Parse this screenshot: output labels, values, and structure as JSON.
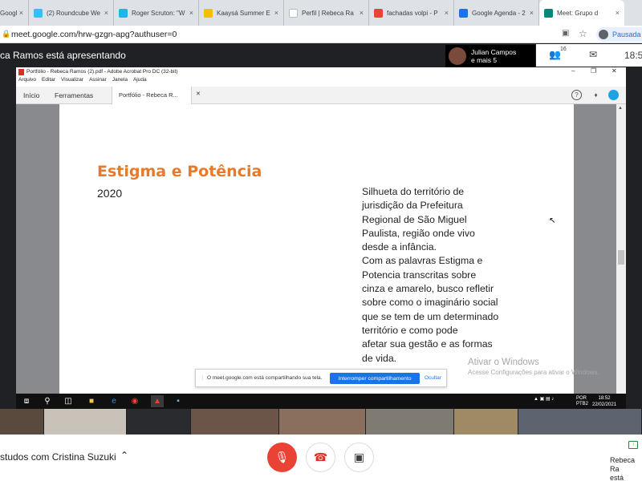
{
  "browser": {
    "tabs": [
      {
        "title": "Googl",
        "icon": "google-icon",
        "color": "#4285f4",
        "active": false
      },
      {
        "title": "(2) Roundcube We",
        "icon": "roundcube-icon",
        "color": "#37beff",
        "active": false
      },
      {
        "title": "Roger Scruton: \"W",
        "icon": "v-icon",
        "color": "#1ab7ea",
        "active": false
      },
      {
        "title": "Kaaysá Summer E",
        "icon": "drive-icon",
        "color": "#fbbc04",
        "active": false
      },
      {
        "title": "Perfil | Rebeca Ra",
        "icon": "page-icon",
        "color": "#ffffff",
        "active": false
      },
      {
        "title": "fachadas volpi - P",
        "icon": "google-g-icon",
        "color": "#ea4335",
        "active": false
      },
      {
        "title": "Google Agenda - 2",
        "icon": "calendar-icon",
        "color": "#1a73e8",
        "active": false
      },
      {
        "title": "Meet: Grupo d",
        "icon": "meet-icon",
        "color": "#00897b",
        "active": true
      }
    ],
    "url": "meet.google.com/hrw-gzgn-apg?authuser=0",
    "profile_label": "Pausada"
  },
  "meet": {
    "presenting_banner": "ca Ramos está apresentando",
    "pip_name": "Julian Campos",
    "pip_more": "e mais 5",
    "participants_count": "16",
    "clock": "18:5",
    "meeting_title": "studos com Cristina Suzuki",
    "presenter_label_1": "Rebeca Ra",
    "presenter_label_2": "está apresen"
  },
  "acrobat": {
    "window_title": "Portfólio - Rebeca Ramos (2).pdf - Adobe Acrobat Pro DC (32-bit)",
    "menu": [
      "Arquivo",
      "Editar",
      "Visualizar",
      "Assinar",
      "Janela",
      "Ajuda"
    ],
    "tabs": {
      "home": "Início",
      "tools": "Ferramentas",
      "document": "Portfólio - Rebeca R..."
    },
    "page": {
      "heading": "Estigma e Potência",
      "year": "2020",
      "description_lines": [
        "Silhueta do território de",
        "jurisdição da Prefeitura",
        "Regional de São Miguel",
        "Paulista, região onde vivo",
        "desde a infância.",
        "Com as palavras Estigma e",
        "Potencia transcritas sobre",
        "cinza e amarelo, busco refletir",
        "sobre como o imaginário social",
        "que se tem de  um determinado",
        "território e como pode",
        "afetar sua gestão e as formas",
        "de vida."
      ],
      "heading_color": "#e7792b"
    }
  },
  "windows": {
    "watermark_title": "Ativar o Windows",
    "watermark_sub": "Acesse Configurações para ativar o Windows.",
    "share_message": "O meet.google.com está compartilhando sua tela.",
    "stop_sharing": "Interromper compartilhamento",
    "hide": "Ocultar",
    "lang_1": "POR",
    "lang_2": "PTB2",
    "time": "18:52",
    "date": "22/02/2021"
  }
}
